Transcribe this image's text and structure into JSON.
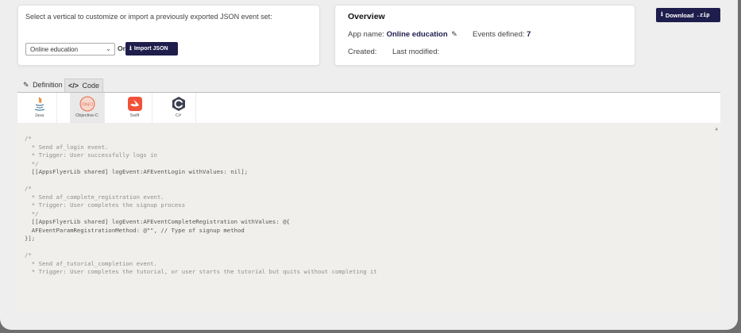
{
  "left_card": {
    "prompt": "Select a vertical to customize or import a previously exported JSON event set:",
    "vertical_select": "Online education",
    "or_label": "Or",
    "import_button": "Import JSON"
  },
  "overview": {
    "title": "Overview",
    "app_name_label": "App name:",
    "app_name_value": "Online education",
    "events_label": "Events defined:",
    "events_value": "7",
    "created_label": "Created:",
    "modified_label": "Last modified:"
  },
  "download_button": {
    "label": "Download",
    "ext": ".zip"
  },
  "tabs": [
    {
      "label": "Definition"
    },
    {
      "label": "Code"
    }
  ],
  "languages": [
    {
      "name": "Java",
      "icon": "java-icon"
    },
    {
      "name": "Objective-C",
      "icon": "objective-c-icon"
    },
    {
      "name": "Swift",
      "icon": "swift-icon"
    },
    {
      "name": "C#",
      "icon": "csharp-icon"
    }
  ],
  "code_lines": [
    "/*",
    "  * Send af_login event.",
    "  * Trigger: User successfully logs in",
    "  */",
    "  [[AppsFlyerLib shared] logEvent:AFEventLogin withValues: nil];",
    "",
    "/*",
    "  * Send af_complete_registration event.",
    "  * Trigger: User completes the signup process",
    "  */",
    "  [[AppsFlyerLib shared] logEvent:AFEventCompleteRegistration withValues: @{",
    "  AFEventParamRegistrationMethod: @\"\", // Type of signup method",
    "}];",
    "",
    "/*",
    "  * Send af_tutorial_completion event.",
    "  * Trigger: User completes the tutorial, or user starts the tutorial but quits without completing it"
  ],
  "colors": {
    "brand_dark": "#1f1d4c",
    "swift_orange": "#f05138"
  }
}
